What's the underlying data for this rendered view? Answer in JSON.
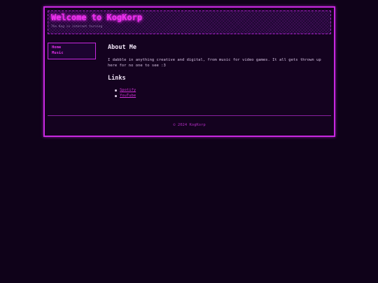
{
  "header": {
    "title": "Welcome to KogKorp",
    "tagline": "The Kog in internet turning"
  },
  "nav": {
    "items": [
      {
        "label": "Home"
      },
      {
        "label": "Music"
      }
    ]
  },
  "about": {
    "heading": "About Me",
    "text": "I dabble in anything creative and digital, from music for video games. It all gets thrown up here for no one to see :3"
  },
  "links": {
    "heading": "Links",
    "items": [
      {
        "label": "Spotify"
      },
      {
        "label": "YouTube"
      }
    ]
  },
  "footer": {
    "text": "© 2024 KogKorp"
  },
  "colors": {
    "background": "#0f0219",
    "accent": "#c828e0",
    "title_glow": "#f030f0",
    "link": "#d030d8"
  }
}
